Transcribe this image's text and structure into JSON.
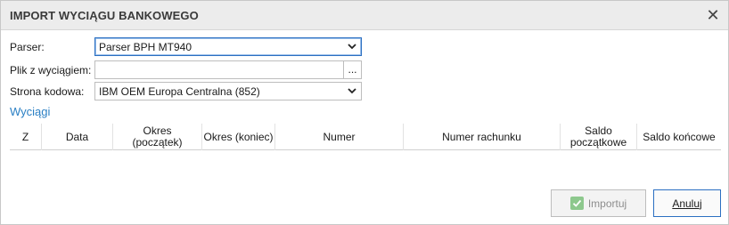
{
  "dialog": {
    "title": "IMPORT WYCIĄGU BANKOWEGO",
    "close_glyph": "✕"
  },
  "form": {
    "parser": {
      "label": "Parser:",
      "value": "Parser BPH MT940"
    },
    "file": {
      "label": "Plik z wyciągiem:",
      "value": "",
      "browse_label": "..."
    },
    "encoding": {
      "label": "Strona kodowa:",
      "value": "IBM OEM Europa Centralna (852)"
    }
  },
  "statements": {
    "section_label": "Wyciągi",
    "columns": [
      "Z",
      "Data",
      "Okres\n(początek)",
      "Okres (koniec)",
      "Numer",
      "Numer rachunku",
      "Saldo\npoczątkowe",
      "Saldo końcowe"
    ],
    "rows": []
  },
  "buttons": {
    "import_label": "Importuj",
    "cancel_label": "Anuluj"
  },
  "colors": {
    "accent": "#2b6fc2",
    "link": "#2a7fc4",
    "import_check": "#8dc88d"
  },
  "icons": {
    "close": "close-icon",
    "dropdown": "chevron-down-icon",
    "import": "check-icon"
  }
}
